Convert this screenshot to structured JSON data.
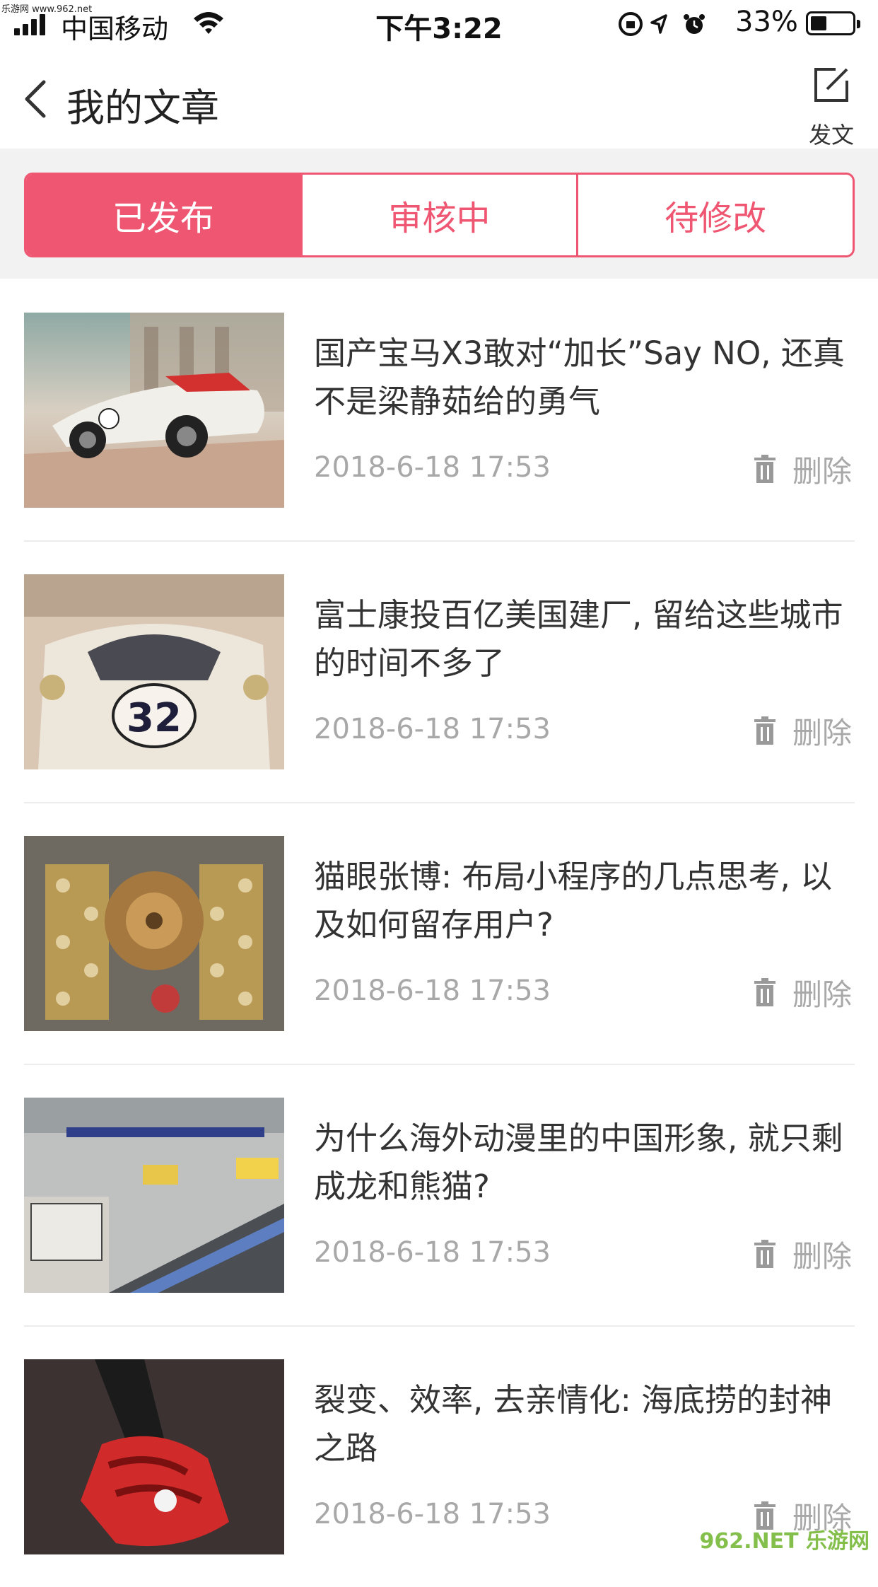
{
  "status_bar": {
    "watermark": "乐游网 www.962.net",
    "carrier": "中国移动",
    "time": "下午3:22",
    "battery": "33%"
  },
  "nav": {
    "title": "我的文章",
    "compose_label": "发文"
  },
  "tabs": [
    {
      "label": "已发布",
      "active": true
    },
    {
      "label": "审核中",
      "active": false
    },
    {
      "label": "待修改",
      "active": false
    }
  ],
  "articles": [
    {
      "title": "国产宝马X3敢对“加长”Say NO, 还真不是梁静茹给的勇气",
      "date": "2018-6-18   17:53",
      "delete_label": "删除",
      "thumb": "race-car-porsche-32-side"
    },
    {
      "title": "富士康投百亿美国建厂, 留给这些城市的时间不多了",
      "date": "2018-6-18   17:53",
      "delete_label": "删除",
      "thumb": "race-car-porsche-32-front"
    },
    {
      "title": "猫眼张博: 布局小程序的几点思考, 以及如何留存用户?",
      "date": "2018-6-18   17:53",
      "delete_label": "删除",
      "thumb": "engine-closeup"
    },
    {
      "title": "为什么海外动漫里的中国形象, 就只剩成龙和熊猫?",
      "date": "2018-6-18   17:53",
      "delete_label": "删除",
      "thumb": "race-pit-lane"
    },
    {
      "title": "裂变、效率, 去亲情化: 海底捞的封神之路",
      "date": "2018-6-18   17:53",
      "delete_label": "删除",
      "thumb": "racing-glove"
    }
  ],
  "watermark_logo": "962.NET 乐游网",
  "colors": {
    "accent": "#ef5672"
  }
}
